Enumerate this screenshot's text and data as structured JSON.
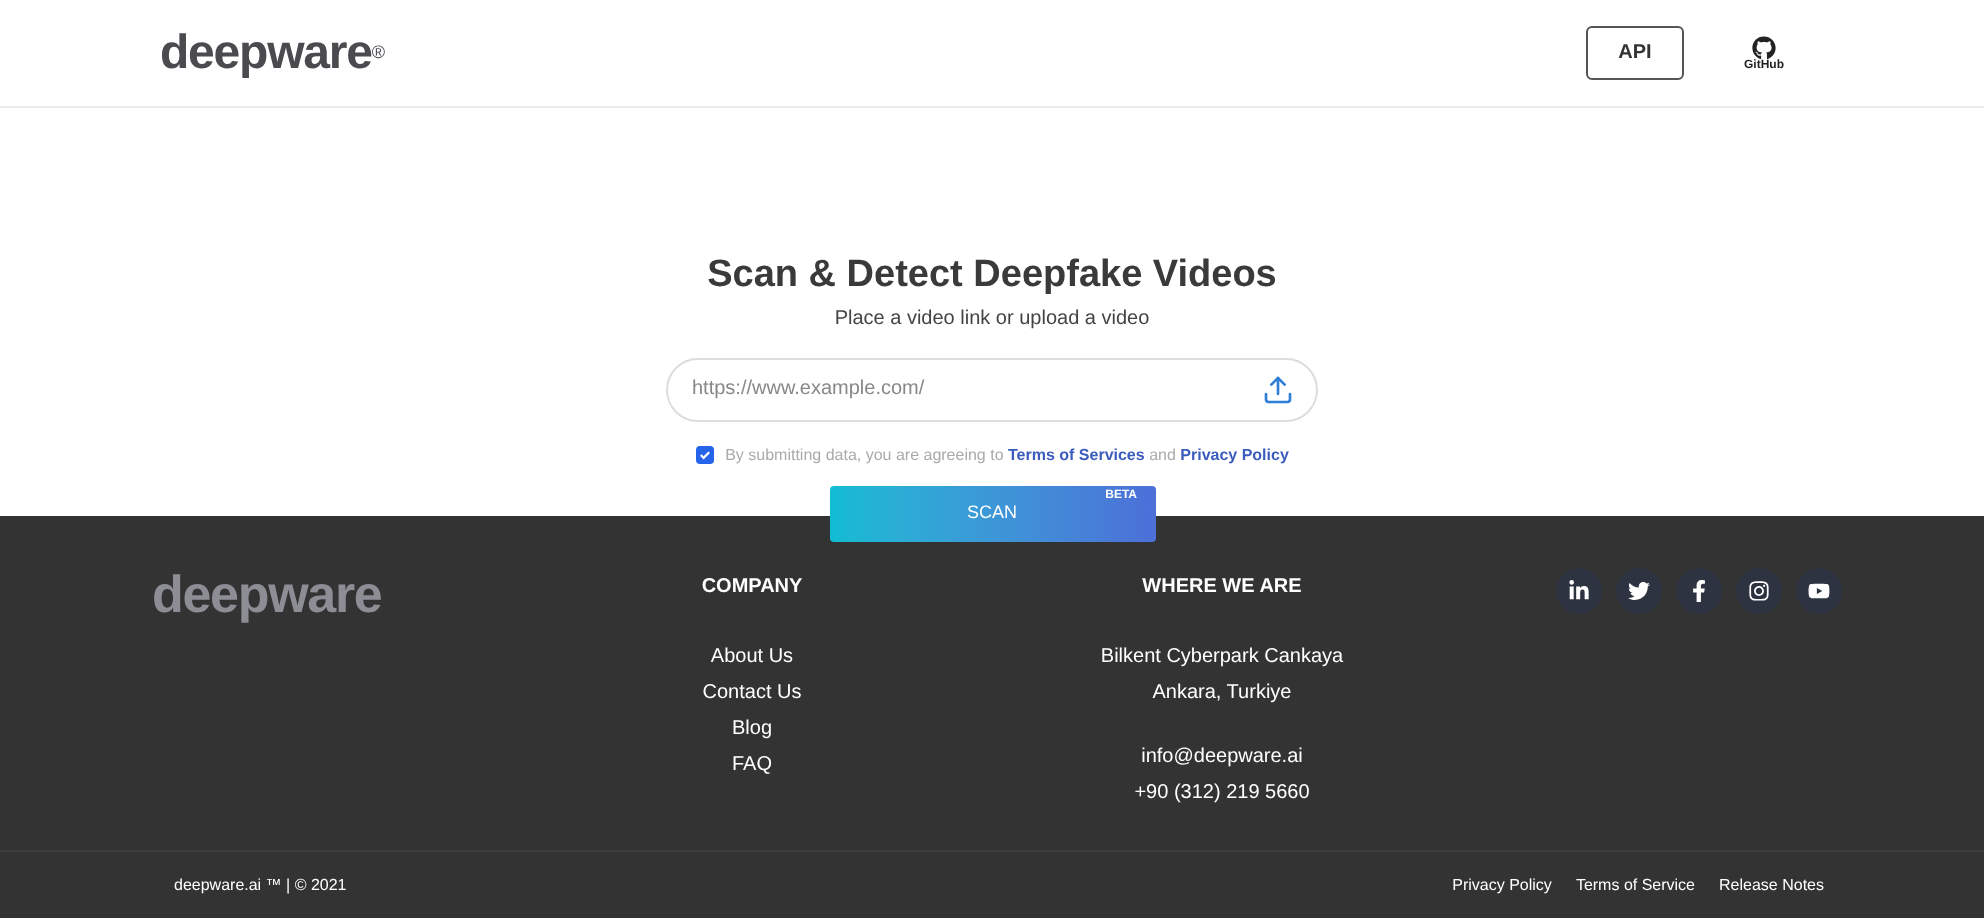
{
  "header": {
    "logo": "deepware",
    "logo_mark": "®",
    "api_button": "API",
    "github_label": "GitHub"
  },
  "hero": {
    "title": "Scan & Detect Deepfake Videos",
    "subtitle": "Place a video link or upload a video",
    "url_field": {
      "placeholder": "https://www.example.com/"
    },
    "consent": {
      "checked": true,
      "text_before": "By submitting data, you are agreeing to ",
      "link_1": "Terms of Services",
      "text_between": " and ",
      "link_2": "Privacy Policy"
    },
    "scan_button": "SCAN",
    "scan_badge": "BETA"
  },
  "footer": {
    "logo": "deepware",
    "company": {
      "heading": "COMPANY",
      "links": [
        "About Us",
        "Contact Us",
        "Blog",
        "FAQ"
      ]
    },
    "where": {
      "heading": "WHERE WE ARE",
      "address": [
        "Bilkent Cyberpark Cankaya",
        "Ankara, Turkiye"
      ],
      "contact": [
        "info@deepware.ai",
        "+90 (312) 219 5660"
      ]
    },
    "social": [
      {
        "kind": "linkedin"
      },
      {
        "kind": "twitter"
      },
      {
        "kind": "facebook"
      },
      {
        "kind": "instagram"
      },
      {
        "kind": "youtube"
      }
    ],
    "copyright": "deepware.ai ™ | © 2021",
    "bottom_links": [
      "Privacy Policy",
      "Terms of Service",
      "Release Notes"
    ]
  }
}
